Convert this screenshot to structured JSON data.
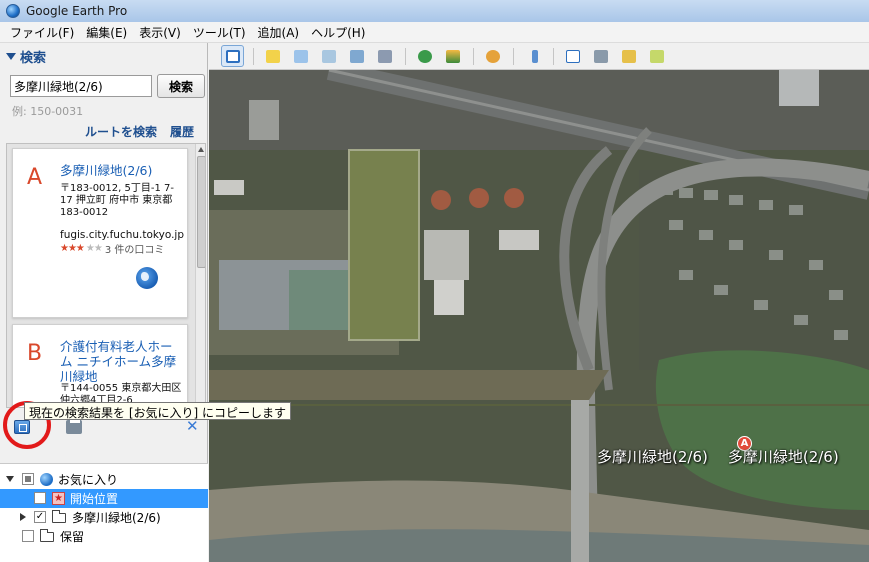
{
  "window": {
    "title": "Google Earth Pro"
  },
  "menu": [
    "ファイル(F)",
    "編集(E)",
    "表示(V)",
    "ツール(T)",
    "追加(A)",
    "ヘルプ(H)"
  ],
  "search": {
    "header": "検索",
    "query": "多摩川緑地(2/6)",
    "button": "検索",
    "example": "例: 150-0031",
    "route_link": "ルートを検索",
    "history_link": "履歴"
  },
  "results": [
    {
      "letter": "A",
      "title": "多摩川緑地(2/6)",
      "address": "〒183-0012, 5丁目-1 7-17 押立町 府中市 東京都 183-0012",
      "url": "fugis.city.fuchu.tokyo.jp",
      "rating": 3,
      "reviews": "3 件の口コミ"
    },
    {
      "letter": "B",
      "title": "介護付有料老人ホーム ニチイホーム多摩川緑地",
      "address": "〒144-0055 東京都大田区仲六郷4丁目2-6"
    }
  ],
  "tooltip": "現在の検索結果を [お気に入り] にコピーします",
  "places": {
    "favorites": "お気に入り",
    "start": "開始位置",
    "folder": "多摩川緑地(2/6)",
    "temp": "保留"
  },
  "map": {
    "label": "多摩川緑地(2/6)",
    "label2": "多摩川緑地(2/6)",
    "marker": "A"
  },
  "colors": {
    "accent": "#1f4f8f",
    "selection": "#3399ff",
    "highlight_circle": "#e21a1a",
    "marker": "#e14b3b"
  }
}
